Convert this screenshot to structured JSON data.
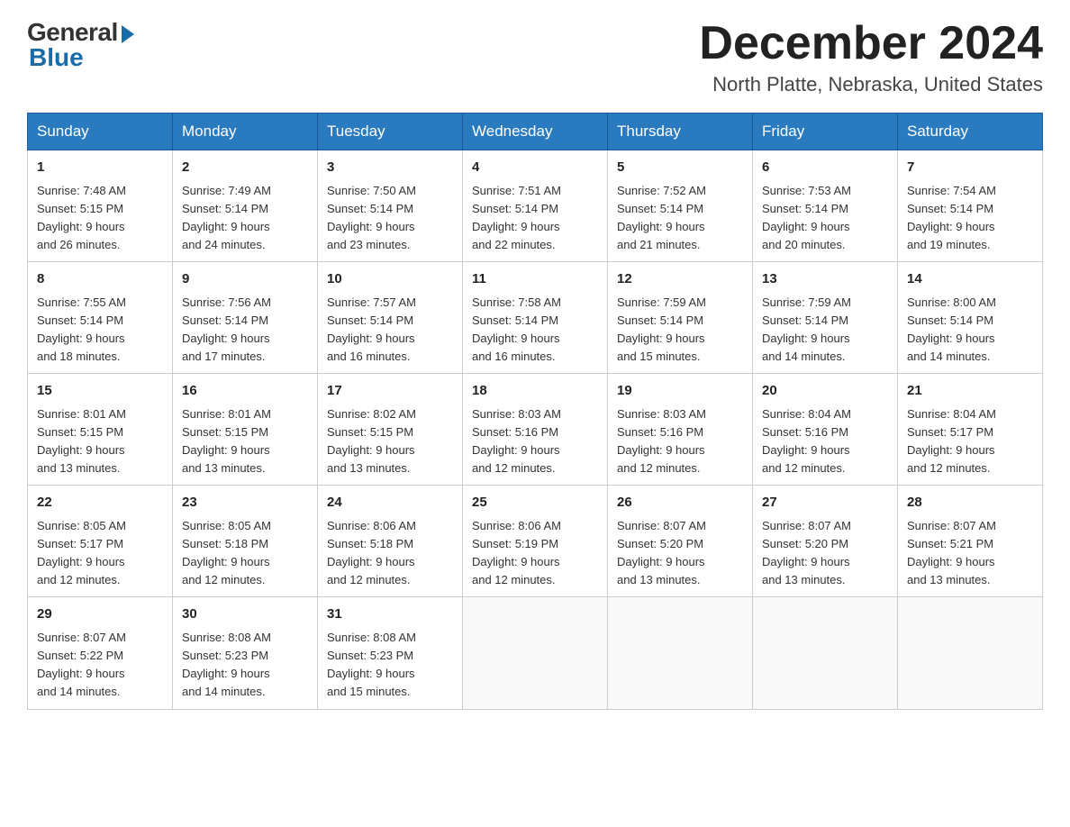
{
  "header": {
    "logo_general": "General",
    "logo_blue": "Blue",
    "month_title": "December 2024",
    "location": "North Platte, Nebraska, United States"
  },
  "calendar": {
    "days_of_week": [
      "Sunday",
      "Monday",
      "Tuesday",
      "Wednesday",
      "Thursday",
      "Friday",
      "Saturday"
    ],
    "weeks": [
      [
        {
          "day": "1",
          "sunrise": "7:48 AM",
          "sunset": "5:15 PM",
          "daylight": "9 hours and 26 minutes."
        },
        {
          "day": "2",
          "sunrise": "7:49 AM",
          "sunset": "5:14 PM",
          "daylight": "9 hours and 24 minutes."
        },
        {
          "day": "3",
          "sunrise": "7:50 AM",
          "sunset": "5:14 PM",
          "daylight": "9 hours and 23 minutes."
        },
        {
          "day": "4",
          "sunrise": "7:51 AM",
          "sunset": "5:14 PM",
          "daylight": "9 hours and 22 minutes."
        },
        {
          "day": "5",
          "sunrise": "7:52 AM",
          "sunset": "5:14 PM",
          "daylight": "9 hours and 21 minutes."
        },
        {
          "day": "6",
          "sunrise": "7:53 AM",
          "sunset": "5:14 PM",
          "daylight": "9 hours and 20 minutes."
        },
        {
          "day": "7",
          "sunrise": "7:54 AM",
          "sunset": "5:14 PM",
          "daylight": "9 hours and 19 minutes."
        }
      ],
      [
        {
          "day": "8",
          "sunrise": "7:55 AM",
          "sunset": "5:14 PM",
          "daylight": "9 hours and 18 minutes."
        },
        {
          "day": "9",
          "sunrise": "7:56 AM",
          "sunset": "5:14 PM",
          "daylight": "9 hours and 17 minutes."
        },
        {
          "day": "10",
          "sunrise": "7:57 AM",
          "sunset": "5:14 PM",
          "daylight": "9 hours and 16 minutes."
        },
        {
          "day": "11",
          "sunrise": "7:58 AM",
          "sunset": "5:14 PM",
          "daylight": "9 hours and 16 minutes."
        },
        {
          "day": "12",
          "sunrise": "7:59 AM",
          "sunset": "5:14 PM",
          "daylight": "9 hours and 15 minutes."
        },
        {
          "day": "13",
          "sunrise": "7:59 AM",
          "sunset": "5:14 PM",
          "daylight": "9 hours and 14 minutes."
        },
        {
          "day": "14",
          "sunrise": "8:00 AM",
          "sunset": "5:14 PM",
          "daylight": "9 hours and 14 minutes."
        }
      ],
      [
        {
          "day": "15",
          "sunrise": "8:01 AM",
          "sunset": "5:15 PM",
          "daylight": "9 hours and 13 minutes."
        },
        {
          "day": "16",
          "sunrise": "8:01 AM",
          "sunset": "5:15 PM",
          "daylight": "9 hours and 13 minutes."
        },
        {
          "day": "17",
          "sunrise": "8:02 AM",
          "sunset": "5:15 PM",
          "daylight": "9 hours and 13 minutes."
        },
        {
          "day": "18",
          "sunrise": "8:03 AM",
          "sunset": "5:16 PM",
          "daylight": "9 hours and 12 minutes."
        },
        {
          "day": "19",
          "sunrise": "8:03 AM",
          "sunset": "5:16 PM",
          "daylight": "9 hours and 12 minutes."
        },
        {
          "day": "20",
          "sunrise": "8:04 AM",
          "sunset": "5:16 PM",
          "daylight": "9 hours and 12 minutes."
        },
        {
          "day": "21",
          "sunrise": "8:04 AM",
          "sunset": "5:17 PM",
          "daylight": "9 hours and 12 minutes."
        }
      ],
      [
        {
          "day": "22",
          "sunrise": "8:05 AM",
          "sunset": "5:17 PM",
          "daylight": "9 hours and 12 minutes."
        },
        {
          "day": "23",
          "sunrise": "8:05 AM",
          "sunset": "5:18 PM",
          "daylight": "9 hours and 12 minutes."
        },
        {
          "day": "24",
          "sunrise": "8:06 AM",
          "sunset": "5:18 PM",
          "daylight": "9 hours and 12 minutes."
        },
        {
          "day": "25",
          "sunrise": "8:06 AM",
          "sunset": "5:19 PM",
          "daylight": "9 hours and 12 minutes."
        },
        {
          "day": "26",
          "sunrise": "8:07 AM",
          "sunset": "5:20 PM",
          "daylight": "9 hours and 13 minutes."
        },
        {
          "day": "27",
          "sunrise": "8:07 AM",
          "sunset": "5:20 PM",
          "daylight": "9 hours and 13 minutes."
        },
        {
          "day": "28",
          "sunrise": "8:07 AM",
          "sunset": "5:21 PM",
          "daylight": "9 hours and 13 minutes."
        }
      ],
      [
        {
          "day": "29",
          "sunrise": "8:07 AM",
          "sunset": "5:22 PM",
          "daylight": "9 hours and 14 minutes."
        },
        {
          "day": "30",
          "sunrise": "8:08 AM",
          "sunset": "5:23 PM",
          "daylight": "9 hours and 14 minutes."
        },
        {
          "day": "31",
          "sunrise": "8:08 AM",
          "sunset": "5:23 PM",
          "daylight": "9 hours and 15 minutes."
        },
        null,
        null,
        null,
        null
      ]
    ]
  },
  "labels": {
    "sunrise_prefix": "Sunrise: ",
    "sunset_prefix": "Sunset: ",
    "daylight_prefix": "Daylight: "
  }
}
